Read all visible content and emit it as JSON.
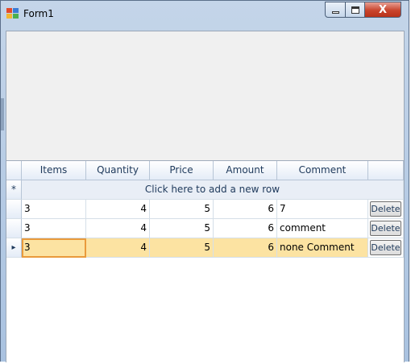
{
  "window": {
    "title": "Form1"
  },
  "title_controls": {
    "minimize": "minimize",
    "maximize": "maximize",
    "close": "close"
  },
  "grid": {
    "columns": [
      "Items",
      "Quantity",
      "Price",
      "Amount",
      "Comment",
      ""
    ],
    "new_row_marker": "*",
    "new_row_text": "Click here to add a new row",
    "current_row_marker": "▸",
    "rows": [
      {
        "items": "3",
        "quantity": "4",
        "price": "5",
        "amount": "6",
        "comment": "7",
        "button": "Delete"
      },
      {
        "items": "3",
        "quantity": "4",
        "price": "5",
        "amount": "6",
        "comment": "comment",
        "button": "Delete"
      },
      {
        "items": "3",
        "quantity": "4",
        "price": "5",
        "amount": "6",
        "comment": "none Comment",
        "button": "Delete"
      }
    ]
  },
  "colors": {
    "selected_row": "#fce3a2",
    "focus_border": "#e99a3c",
    "close_button": "#c9442c"
  }
}
